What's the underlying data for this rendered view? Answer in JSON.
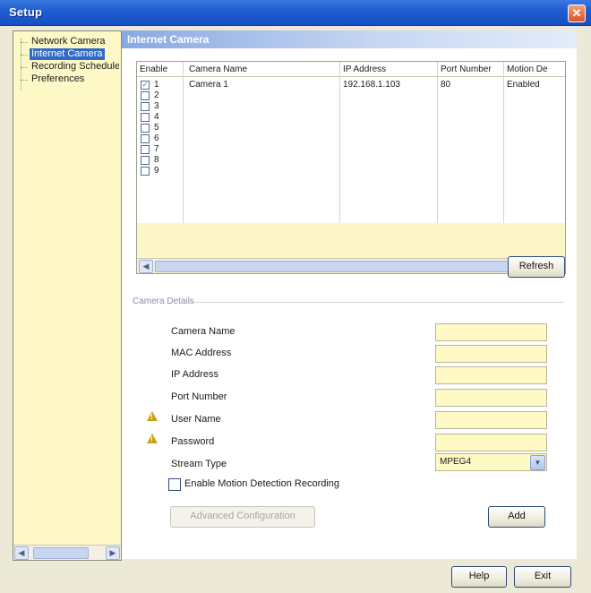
{
  "window": {
    "title": "Setup",
    "close_symbol": "✕"
  },
  "nav": {
    "items": [
      {
        "label": "Network Camera",
        "selected": false
      },
      {
        "label": "Internet Camera",
        "selected": true
      },
      {
        "label": "Recording Schedule",
        "selected": false
      },
      {
        "label": "Preferences",
        "selected": false
      }
    ],
    "scroll_left": "◀",
    "scroll_right": "▶"
  },
  "section": {
    "title": "Internet Camera"
  },
  "camera_table": {
    "columns": [
      "Enable",
      "Camera Name",
      "IP Address",
      "Port Number",
      "Motion De"
    ],
    "rows": [
      {
        "num": "1",
        "checked": true,
        "name": "Camera 1",
        "ip": "192.168.1.103",
        "port": "80",
        "motion": "Enabled"
      },
      {
        "num": "2",
        "checked": false,
        "name": "",
        "ip": "",
        "port": "",
        "motion": ""
      },
      {
        "num": "3",
        "checked": false,
        "name": "",
        "ip": "",
        "port": "",
        "motion": ""
      },
      {
        "num": "4",
        "checked": false,
        "name": "",
        "ip": "",
        "port": "",
        "motion": ""
      },
      {
        "num": "5",
        "checked": false,
        "name": "",
        "ip": "",
        "port": "",
        "motion": ""
      },
      {
        "num": "6",
        "checked": false,
        "name": "",
        "ip": "",
        "port": "",
        "motion": ""
      },
      {
        "num": "7",
        "checked": false,
        "name": "",
        "ip": "",
        "port": "",
        "motion": ""
      },
      {
        "num": "8",
        "checked": false,
        "name": "",
        "ip": "",
        "port": "",
        "motion": ""
      },
      {
        "num": "9",
        "checked": false,
        "name": "",
        "ip": "",
        "port": "",
        "motion": ""
      }
    ],
    "scroll_left": "◀",
    "scroll_right": "▶"
  },
  "refresh_label": "Refresh",
  "details": {
    "group_label": "Camera Details",
    "camera_name_label": "Camera Name",
    "mac_address_label": "MAC Address",
    "ip_address_label": "IP Address",
    "port_number_label": "Port Number",
    "user_name_label": "User Name",
    "password_label": "Password",
    "stream_type_label": "Stream Type",
    "stream_type_value": "MPEG4",
    "camera_name_value": "",
    "mac_address_value": "",
    "ip_address_value": "",
    "port_number_value": "",
    "user_name_value": "",
    "password_value": "",
    "motion_recording_label": "Enable Motion Detection Recording",
    "motion_recording_checked": false,
    "advanced_label": "Advanced Configuration",
    "add_label": "Add"
  },
  "footer": {
    "help_label": "Help",
    "exit_label": "Exit"
  },
  "colors": {
    "titlebar": "#1f5bd1",
    "nav_bg": "#fdf8c6",
    "selection": "#316ac5",
    "field_bg": "#fff9c6",
    "warning": "#c9a316"
  }
}
